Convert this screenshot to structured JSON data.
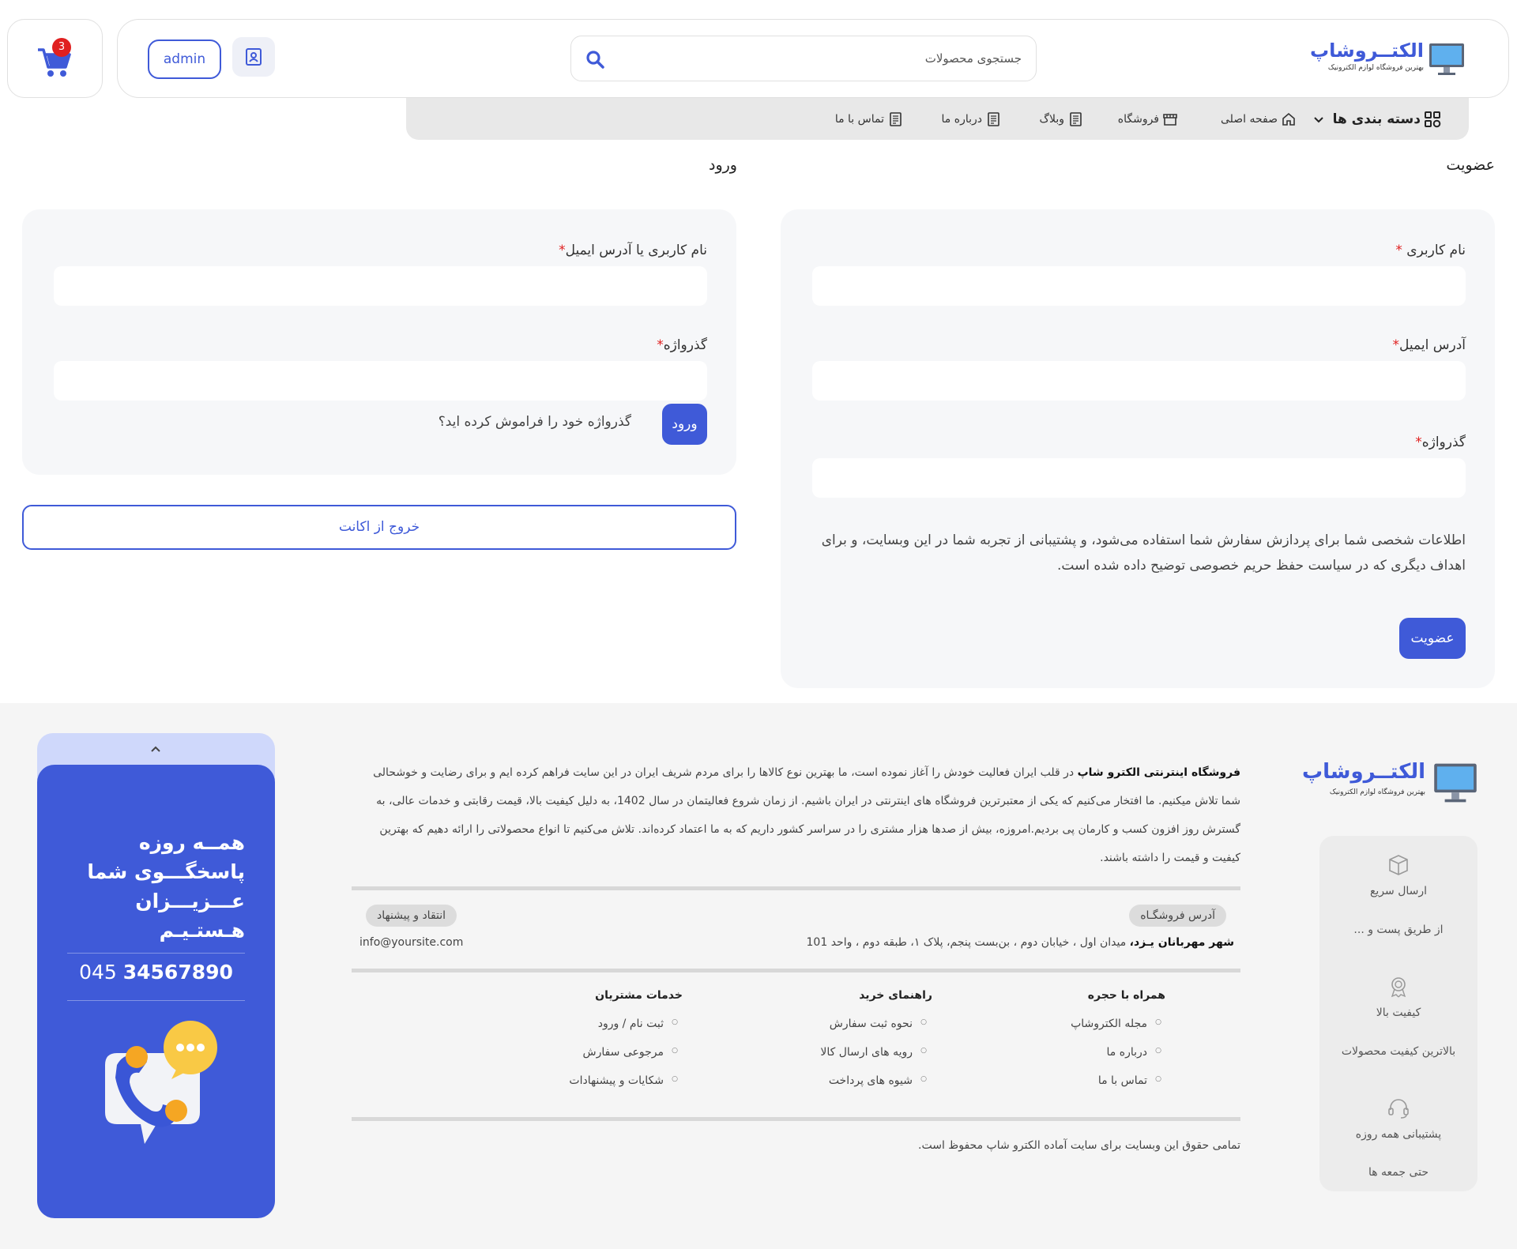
{
  "header": {
    "cart_count": "3",
    "logo_title": "الکتــروشاپ",
    "logo_subtitle": "بهترین فروشگاه لوازم الکترونیک",
    "search_placeholder": "جستجوی محصولات",
    "admin_label": "admin"
  },
  "nav": {
    "categories": "دسته بندی ها",
    "items": [
      "صفحه اصلی",
      "فروشگاه",
      "وبلاگ",
      "درباره ما",
      "تماس با ما"
    ]
  },
  "register": {
    "title": "عضویت",
    "username_label": "نام کاربری",
    "email_label": "آدرس ایمیل",
    "password_label": "گذرواژه",
    "privacy_text": "اطلاعات شخصی شما برای پردازش سفارش شما استفاده می‌شود، و پشتیبانی از تجربه شما در این وبسایت، و برای اهداف دیگری که در سیاست حفظ حریم خصوصی توضیح داده شده است.",
    "submit_label": "عضویت"
  },
  "login": {
    "title": "ورود",
    "username_label": "نام کاربری یا آدرس ایمیل",
    "password_label": "گذرواژه",
    "submit_label": "ورود",
    "forgot_label": "گذرواژه خود را فراموش کرده اید؟",
    "logout_label": "خروج از اکانت"
  },
  "footer": {
    "logo_title": "الکتــروشاپ",
    "logo_subtitle": "بهترین فروشگاه لوازم الکترونیک",
    "features": [
      {
        "title": "ارسال سریع",
        "desc": "از طریق پست و ..."
      },
      {
        "title": "کیفیت بالا",
        "desc": "بالاترین کیفیت محصولات"
      },
      {
        "title": "پشتیبانی همه روزه",
        "desc": "حتی جمعه ها"
      }
    ],
    "about_bold": "فروشگاه اینترنتی الکترو شاپ",
    "about_text": " در قلب ایران فعالیت خودش را آغاز نموده است، ما بهترین نوع کالاها را برای مردم شریف ایران در این سایت فراهم کرده ایم و برای رضایت و خوشحالی شما تلاش میکنیم. ما افتخار می‌کنیم که یکی از معتبرترین فروشگاه های اینترنتی در ایران باشیم. از زمان شروع فعالیتمان در سال 1402، به دلیل کیفیت بالا، قیمت رقابتی و خدمات عالی، به گسترش روز افزون کسب و کارمان پی بردیم.امروزه، بیش از صدها هزار مشتری را در سراسر کشور داریم که به ما اعتماد کرده‌اند. تلاش می‌کنیم تا انواع محصولاتی را ارائه دهیم که بهترین کیفیت و قیمت را داشته باشند.",
    "address_pill": "آدرس فروشگـاه",
    "address_bold": "شهر مهربانان یـزد،",
    "address_text": " میدان اول ، خیابان دوم ، بن‌بست پنجم، پلاک ۱، طبقه دوم ، واحد 101",
    "feedback_pill": "انتقاد و پیشنهاد",
    "email": "info@yoursite.com",
    "columns": [
      {
        "title": "همراه با حجره",
        "items": [
          "مجله الکتروشاپ",
          "درباره ما",
          "تماس با ما"
        ]
      },
      {
        "title": "راهنمای خرید",
        "items": [
          "نحوه ثبت سفارش",
          "رویه های ارسال کالا",
          "شیوه های پرداخت"
        ]
      },
      {
        "title": "خدمات مشتریان",
        "items": [
          "ثبت نام / ورود",
          "مرجوعی سفارش",
          "شکایات و پیشنهادات"
        ]
      }
    ],
    "copyright": "تمامی حقوق این وبسایت برای سایت آماده الکترو شاپ محفوظ است."
  },
  "support": {
    "line1": "همــه روزه",
    "line2": "پاسخگـــوی شما",
    "line3": "عـــزیـــزان",
    "line4": "هـستـیـم",
    "phone_prefix": "045",
    "phone_number": "34567890"
  },
  "colors": {
    "primary": "#3f5ad8",
    "badge": "#e02020",
    "card_bg": "#f6f7f9"
  }
}
